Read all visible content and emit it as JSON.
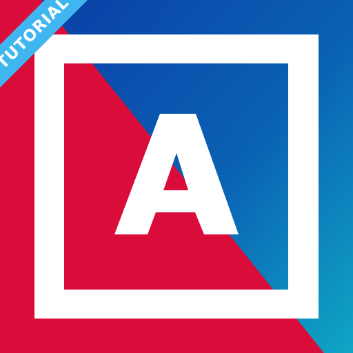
{
  "ribbon": {
    "label": "TUTORIAL",
    "color": "#3fb6f0",
    "text_color": "#ffffff"
  },
  "logo": {
    "letter": "A",
    "icon": "letter-a-logo-icon",
    "colors": {
      "red": "#d90c3a",
      "blue_start": "#0a3fa6",
      "blue_end": "#0fa0c4",
      "frame": "#ffffff"
    }
  }
}
